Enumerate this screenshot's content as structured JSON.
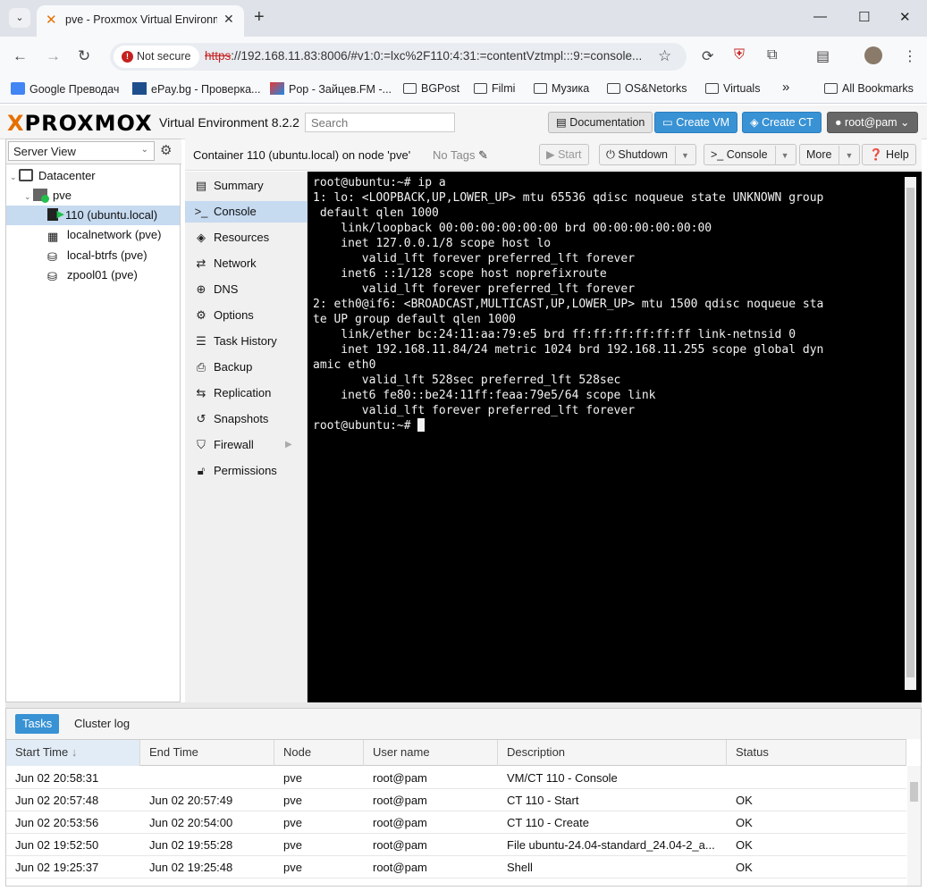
{
  "browser": {
    "tab_title": "pve - Proxmox Virtual Environment",
    "not_secure": "Not secure",
    "url_scheme": "https",
    "url_rest": "://192.168.11.83:8006/#v1:0:=lxc%2F110:4:31:=contentVztmpl:::9:=console...",
    "bookmarks": [
      {
        "label": "Google Преводач",
        "icon": "google-translate-icon"
      },
      {
        "label": "ePay.bg - Проверка...",
        "icon": "epay-icon"
      },
      {
        "label": "Pop - Зайцев.FM -...",
        "icon": "radio-icon"
      },
      {
        "label": "BGPost",
        "icon": "folder-icon"
      },
      {
        "label": "Filmi",
        "icon": "folder-icon"
      },
      {
        "label": "Музика",
        "icon": "folder-icon"
      },
      {
        "label": "OS&Netorks",
        "icon": "folder-icon"
      },
      {
        "label": "Virtuals",
        "icon": "folder-icon"
      }
    ],
    "more_bookmarks": "»",
    "all_bookmarks": "All Bookmarks"
  },
  "pve": {
    "logo_x": "X",
    "logo_rest": "PROXMOX",
    "version": "Virtual Environment 8.2.2",
    "search_placeholder": "Search",
    "documentation": "Documentation",
    "create_vm": "Create VM",
    "create_ct": "Create CT",
    "user": "root@pam"
  },
  "tree": {
    "view": "Server View",
    "items": [
      {
        "label": "Datacenter",
        "icon": "datacenter-icon"
      },
      {
        "label": "pve",
        "icon": "node-icon"
      },
      {
        "label": "110 (ubuntu.local)",
        "icon": "container-running-icon"
      },
      {
        "label": "localnetwork (pve)",
        "icon": "network-icon"
      },
      {
        "label": "local-btrfs (pve)",
        "icon": "storage-icon"
      },
      {
        "label": "zpool01 (pve)",
        "icon": "storage-icon"
      }
    ]
  },
  "container": {
    "title": "Container 110 (ubuntu.local) on node 'pve'",
    "tags": "No Tags",
    "start": "Start",
    "shutdown": "Shutdown",
    "console": "Console",
    "more": "More",
    "help": "Help"
  },
  "menu": [
    {
      "label": "Summary",
      "icon": "summary-icon"
    },
    {
      "label": "Console",
      "icon": "console-icon"
    },
    {
      "label": "Resources",
      "icon": "resources-icon"
    },
    {
      "label": "Network",
      "icon": "network-icon"
    },
    {
      "label": "DNS",
      "icon": "dns-icon"
    },
    {
      "label": "Options",
      "icon": "options-icon"
    },
    {
      "label": "Task History",
      "icon": "task-history-icon"
    },
    {
      "label": "Backup",
      "icon": "backup-icon"
    },
    {
      "label": "Replication",
      "icon": "replication-icon"
    },
    {
      "label": "Snapshots",
      "icon": "snapshots-icon"
    },
    {
      "label": "Firewall",
      "icon": "firewall-icon"
    },
    {
      "label": "Permissions",
      "icon": "permissions-icon"
    }
  ],
  "terminal": {
    "lines": [
      "root@ubuntu:~# ip a",
      "1: lo: <LOOPBACK,UP,LOWER_UP> mtu 65536 qdisc noqueue state UNKNOWN group",
      " default qlen 1000",
      "    link/loopback 00:00:00:00:00:00 brd 00:00:00:00:00:00",
      "    inet 127.0.0.1/8 scope host lo",
      "       valid_lft forever preferred_lft forever",
      "    inet6 ::1/128 scope host noprefixroute",
      "       valid_lft forever preferred_lft forever",
      "2: eth0@if6: <BROADCAST,MULTICAST,UP,LOWER_UP> mtu 1500 qdisc noqueue sta",
      "te UP group default qlen 1000",
      "    link/ether bc:24:11:aa:79:e5 brd ff:ff:ff:ff:ff:ff link-netnsid 0",
      "    inet 192.168.11.84/24 metric 1024 brd 192.168.11.255 scope global dyn",
      "amic eth0",
      "       valid_lft 528sec preferred_lft 528sec",
      "    inet6 fe80::be24:11ff:feaa:79e5/64 scope link",
      "       valid_lft forever preferred_lft forever"
    ],
    "prompt": "root@ubuntu:~# "
  },
  "tasks": {
    "tabs": [
      "Tasks",
      "Cluster log"
    ],
    "columns": [
      "Start Time",
      "End Time",
      "Node",
      "User name",
      "Description",
      "Status"
    ],
    "sort_arrow": "↓",
    "rows": [
      {
        "start": "Jun 02 20:58:31",
        "end": "",
        "node": "pve",
        "user": "root@pam",
        "desc": "VM/CT 110 - Console",
        "status": ""
      },
      {
        "start": "Jun 02 20:57:48",
        "end": "Jun 02 20:57:49",
        "node": "pve",
        "user": "root@pam",
        "desc": "CT 110 - Start",
        "status": "OK"
      },
      {
        "start": "Jun 02 20:53:56",
        "end": "Jun 02 20:54:00",
        "node": "pve",
        "user": "root@pam",
        "desc": "CT 110 - Create",
        "status": "OK"
      },
      {
        "start": "Jun 02 19:52:50",
        "end": "Jun 02 19:55:28",
        "node": "pve",
        "user": "root@pam",
        "desc": "File ubuntu-24.04-standard_24.04-2_a...",
        "status": "OK"
      },
      {
        "start": "Jun 02 19:25:37",
        "end": "Jun 02 19:25:48",
        "node": "pve",
        "user": "root@pam",
        "desc": "Shell",
        "status": "OK"
      }
    ]
  },
  "colors": {
    "accent": "#3892d4",
    "selection": "#c6daf0",
    "proxmox_orange": "#e57000",
    "not_secure": "#c5221f"
  }
}
